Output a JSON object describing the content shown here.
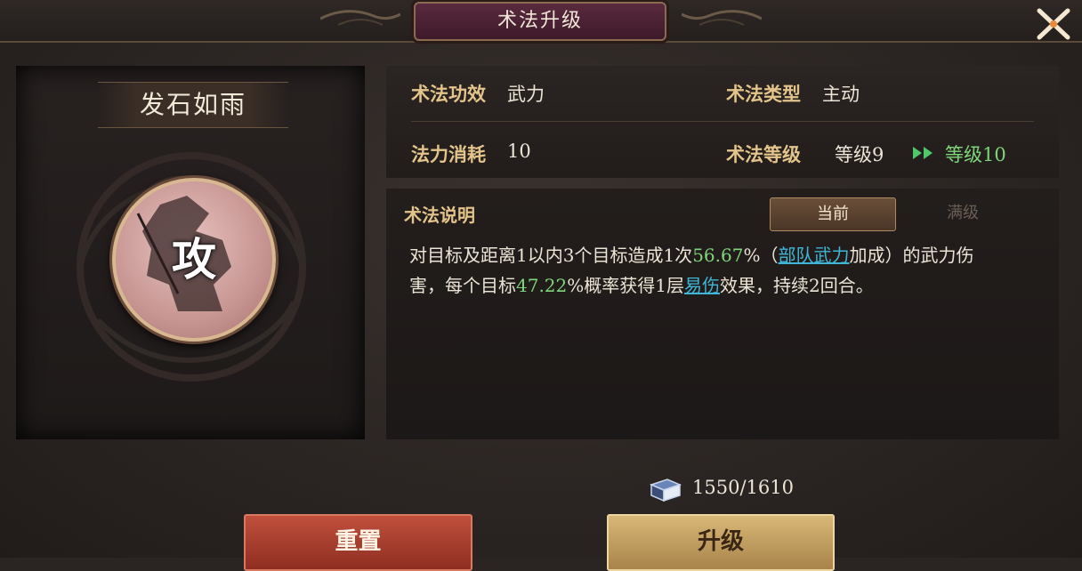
{
  "header": {
    "title": "术法升级",
    "close_icon": "close-x-icon"
  },
  "skill": {
    "name": "发石如雨",
    "emblem_glyph": "攻"
  },
  "stats": {
    "effect_label": "术法功效",
    "effect_value": "武力",
    "type_label": "术法类型",
    "type_value": "主动",
    "cost_label": "法力消耗",
    "cost_value": "10",
    "level_label": "术法等级",
    "level_current": "等级9",
    "level_next": "等级10",
    "arrow_icon": "double-arrow-right-icon"
  },
  "description": {
    "title": "术法说明",
    "tabs": [
      {
        "label": "当前",
        "active": true
      },
      {
        "label": "满级",
        "active": false
      }
    ],
    "line1_a": "对目标及距离1以内3个目标造成1次",
    "line1_pct": "56.67",
    "line1_b": "%（",
    "line1_link": "部队武力",
    "line1_c": "加成）的武力伤",
    "line2_a": "害，每个目标",
    "line2_pct": "47.22",
    "line2_b": "%概率获得1层",
    "line2_link": "易伤",
    "line2_c": "效果，持续2回合。"
  },
  "resources": {
    "book_icon": "skill-book-icon",
    "amount": "1550/1610"
  },
  "buttons": {
    "reset_label": "重置",
    "upgrade_label": "升级"
  },
  "colors": {
    "accent_gold": "#e3c48a",
    "green": "#7fd67a",
    "link": "#3fb6d8",
    "reset": "#a83c2c",
    "upgrade": "#c8a464"
  }
}
